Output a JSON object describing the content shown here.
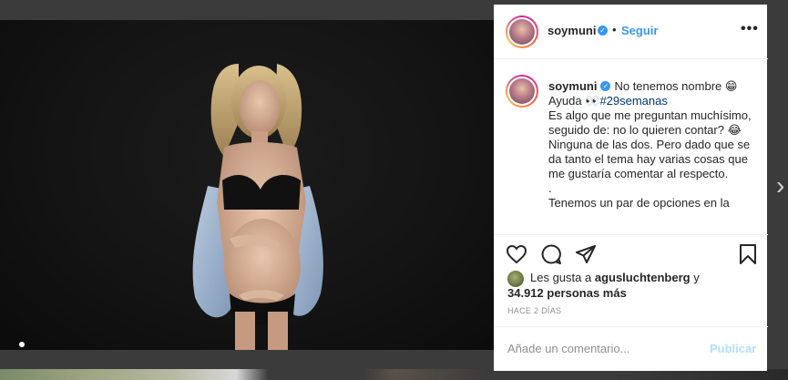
{
  "header": {
    "username": "soymuni",
    "dot": "•",
    "follow_label": "Seguir",
    "more_label": "•••"
  },
  "caption": {
    "username": "soymuni",
    "line1": "No tenemos nombre 😁",
    "ayuda": "Ayuda 👀",
    "hashtag": "#29semanas",
    "body": "Es algo que me preguntan muchísimo, seguido de: no lo quieren contar? 😂Ninguna de las dos. Pero dado que se da tanto el tema hay varias cosas que me gustaría comentar al respecto.",
    "dot_line": ".",
    "tail": "Tenemos un par de opciones en la"
  },
  "likes": {
    "prefix": "Les gusta a",
    "user": "aguslucht enberg",
    "user_display": "agusluchtenberg",
    "and": "y",
    "count": "34.912 personas más"
  },
  "time": "HACE 2 DÍAS",
  "add_comment": {
    "placeholder": "Añade un comentario...",
    "publish_label": "Publicar"
  },
  "colors": {
    "link_blue": "#3897f0",
    "hashtag": "#00376b",
    "publish_disabled": "#b2dffc",
    "muted": "#8e8e8e"
  },
  "icons": [
    "heart-icon",
    "comment-icon",
    "share-icon",
    "bookmark-icon",
    "user-tag-icon",
    "chevron-right-icon",
    "verified-icon"
  ]
}
